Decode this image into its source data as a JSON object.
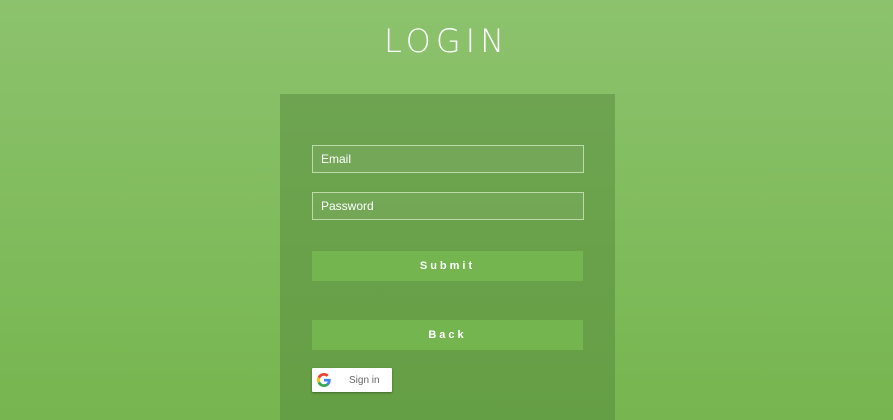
{
  "header": {
    "title": "LOGIN"
  },
  "form": {
    "email": {
      "value": "",
      "placeholder": "Email"
    },
    "password": {
      "value": "",
      "placeholder": "Password"
    },
    "submit_label": "Submit",
    "back_label": "Back",
    "google": {
      "label": "Sign in",
      "icon": "google-icon"
    }
  },
  "colors": {
    "background": "#82bd60",
    "panel": "#6b9e52",
    "button": "#74b550",
    "text": "#ffffff"
  }
}
